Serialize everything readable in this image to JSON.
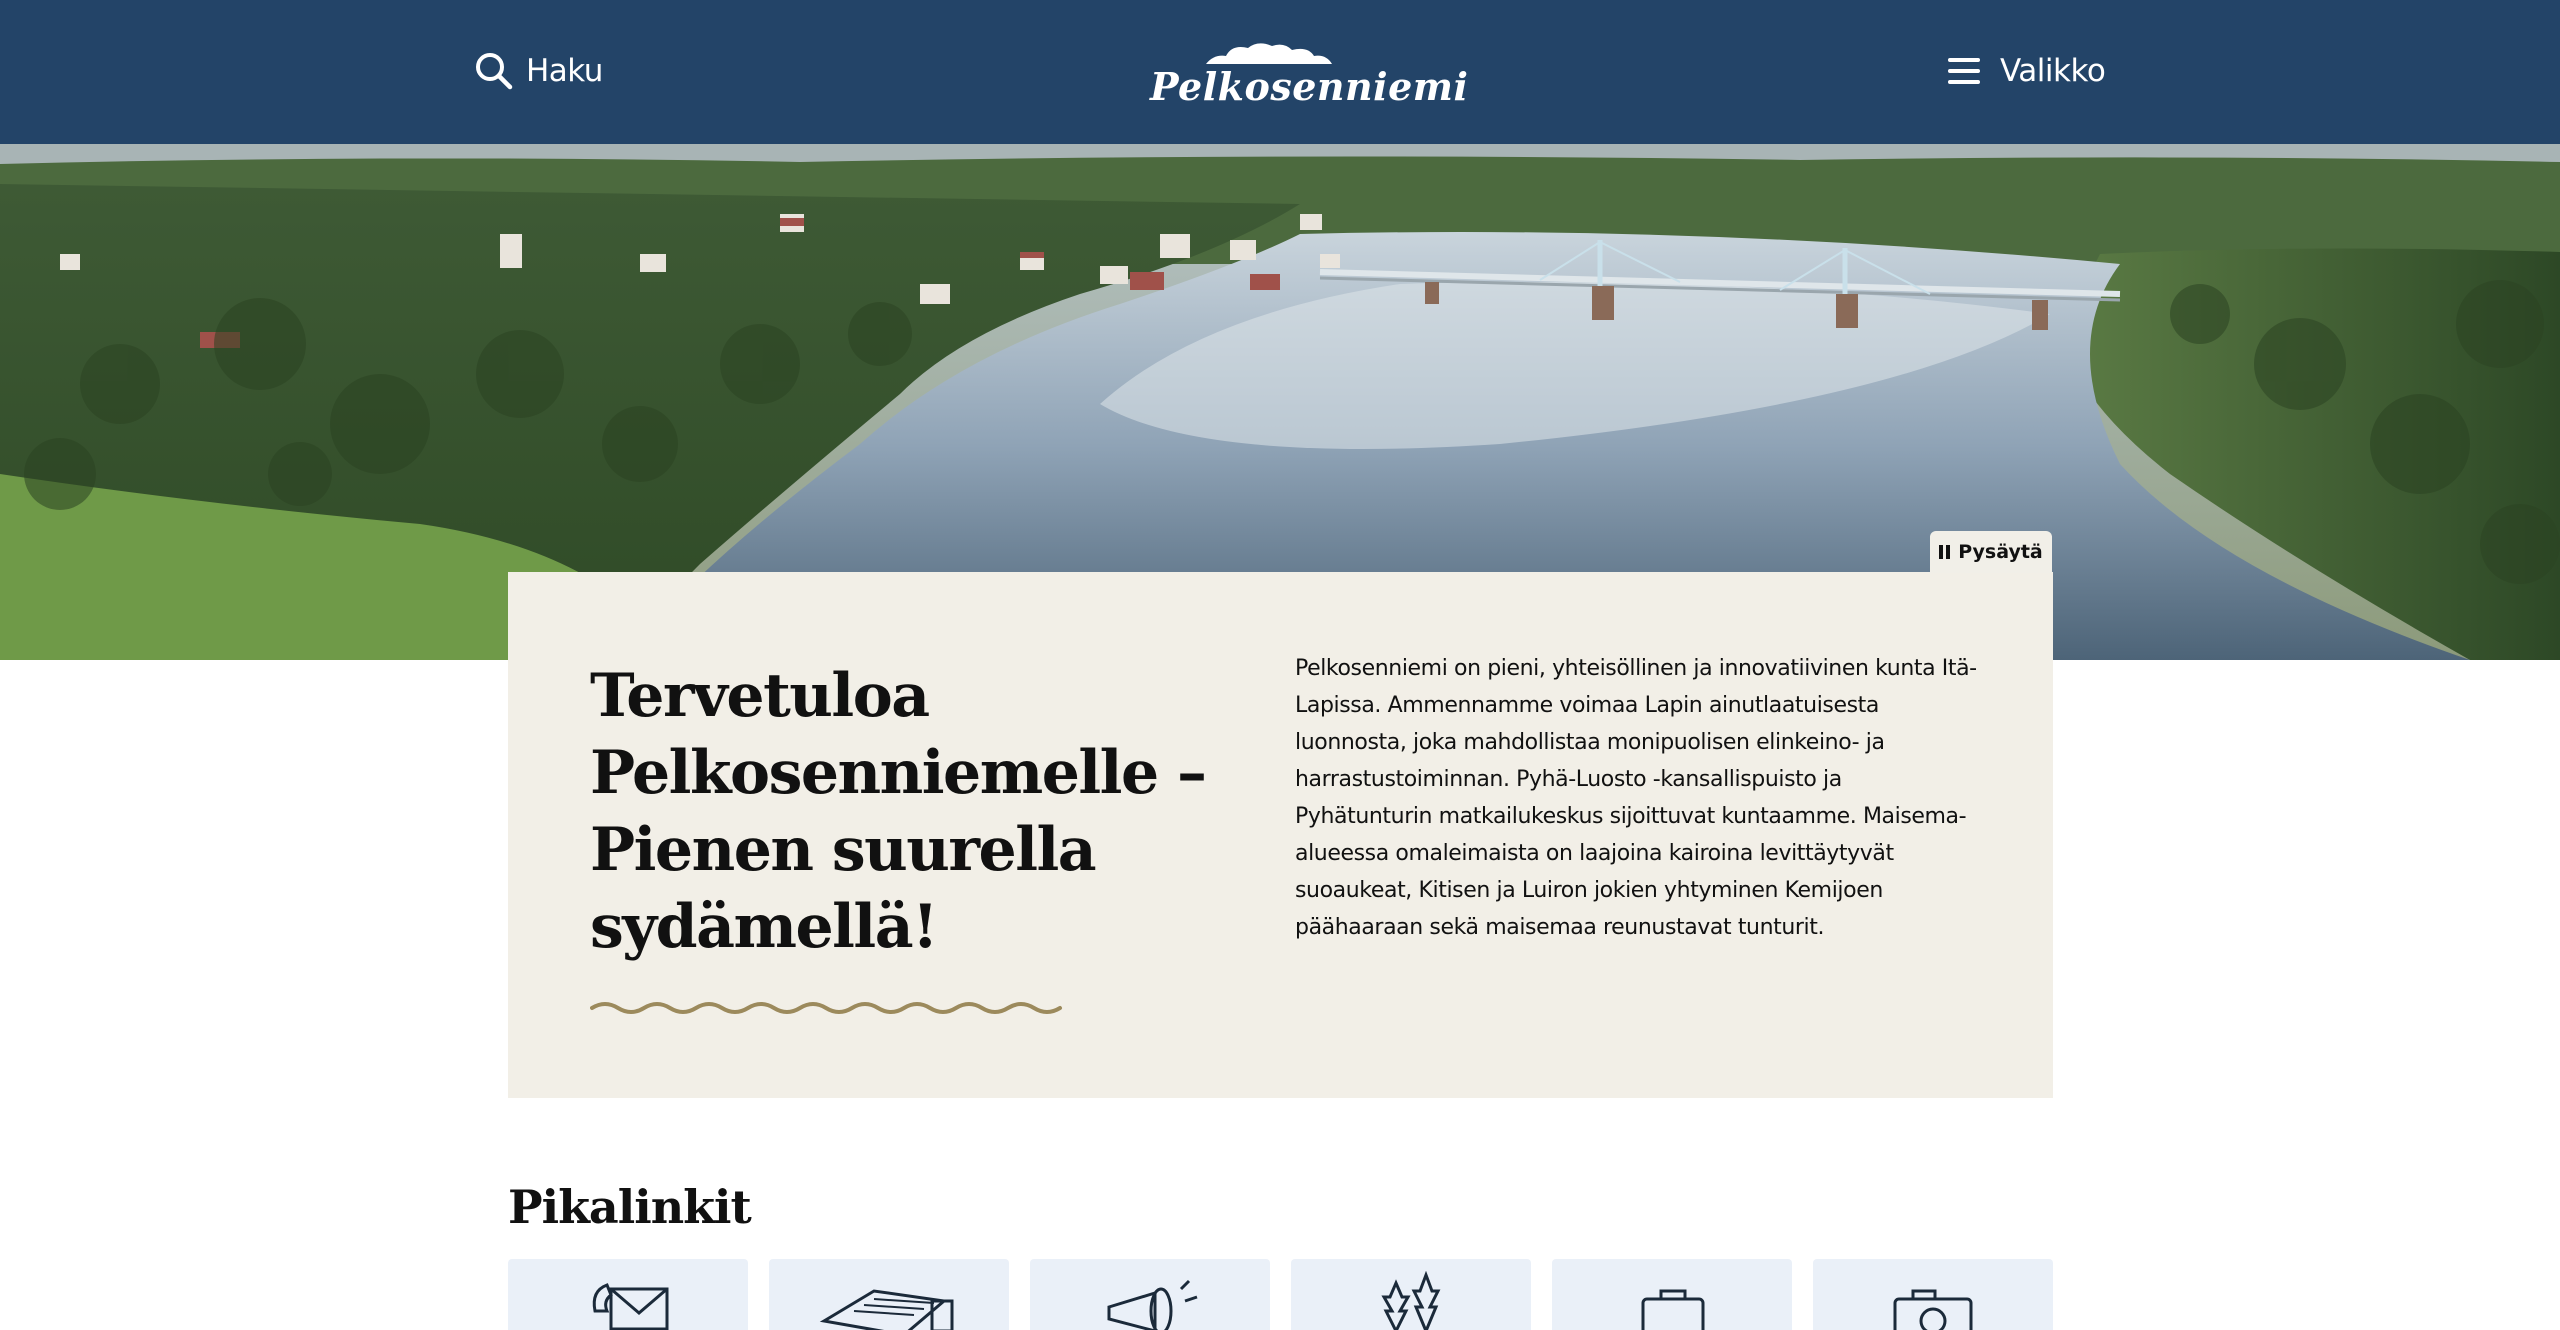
{
  "header": {
    "search_label": "Haku",
    "logo_text": "Pelkosenniemi",
    "menu_label": "Valikko",
    "background_color": "#234468"
  },
  "hero": {
    "pause_label": "Pysäytä"
  },
  "intro": {
    "title": "Tervetuloa Pelkosenniemelle – Pienen suurella sydämellä!",
    "text": "Pelkosenniemi on pieni, yhteisöllinen ja innovatiivinen kunta Itä-Lapissa. Ammennamme voimaa Lapin ainutlaatuisesta luonnosta, joka mahdollistaa monipuolisen elinkeino- ja harrastustoiminnan. Pyhä-Luosto -kansallispuisto ja Pyhätunturin matkailukeskus sijoittuvat kuntaamme. Maisema-alueessa omaleimaista on laajoina kairoina levittäytyvät suoaukeat, Kitisen ja Luiron jokien yhtyminen Kemijoen päähaaraan sekä maisemaa reunustavat tunturit.",
    "card_color": "#f2efe7",
    "wave_color": "#9c8a5c"
  },
  "quick_links": {
    "title": "Pikalinkit",
    "items": [
      {
        "icon": "envelope-phone-icon"
      },
      {
        "icon": "newspaper-icon"
      },
      {
        "icon": "megaphone-icon"
      },
      {
        "icon": "pine-trees-icon"
      },
      {
        "icon": "briefcase-icon"
      },
      {
        "icon": "camera-icon"
      }
    ],
    "card_color": "#eaf0f8"
  }
}
